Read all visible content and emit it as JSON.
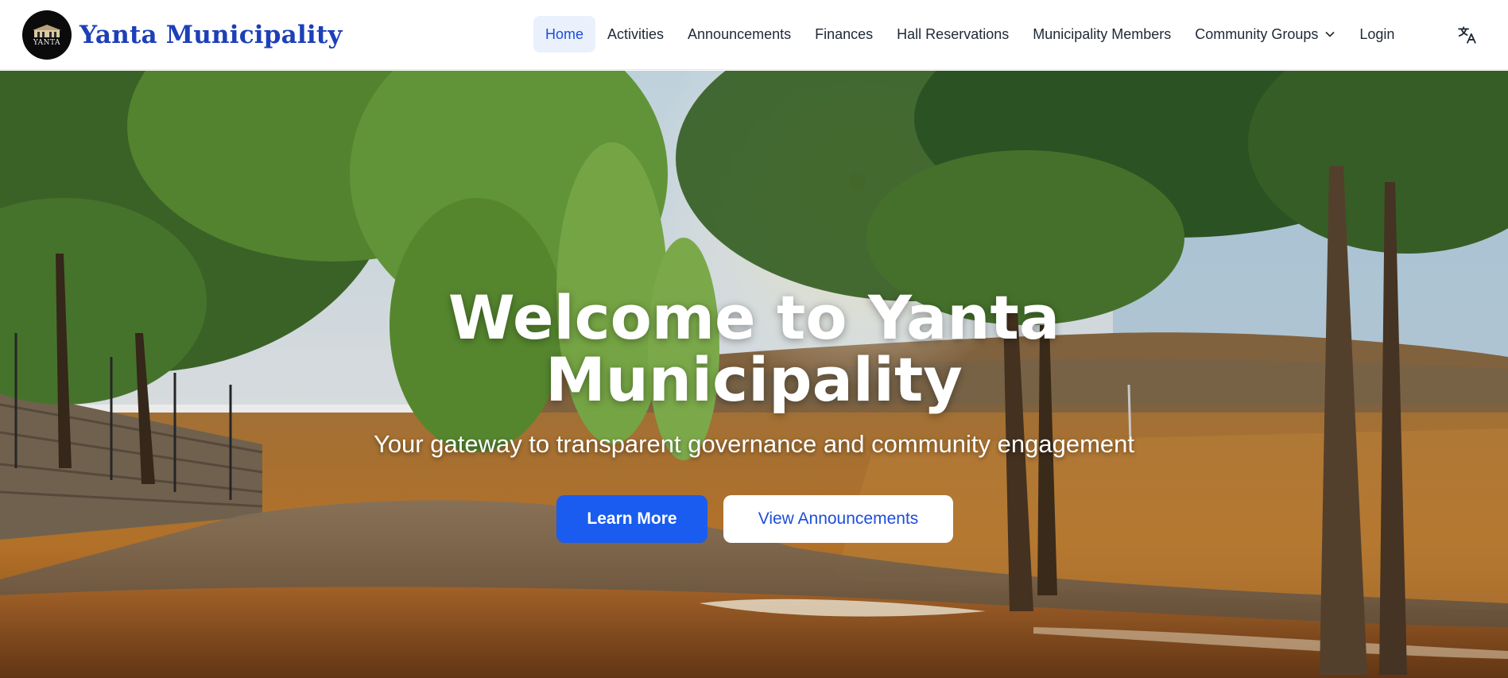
{
  "brand": {
    "name": "Yanta Municipality",
    "logo_text": "YANTA"
  },
  "nav": {
    "items": [
      {
        "label": "Home",
        "active": true
      },
      {
        "label": "Activities"
      },
      {
        "label": "Announcements"
      },
      {
        "label": "Finances"
      },
      {
        "label": "Hall Reservations"
      },
      {
        "label": "Municipality Members"
      },
      {
        "label": "Community Groups",
        "icon": "chevron-down-icon"
      },
      {
        "label": "Login"
      }
    ],
    "language_icon": "translate-icon"
  },
  "hero": {
    "title_line1": "Welcome to Yanta",
    "title_line2": "Municipality",
    "subtitle": "Your gateway to transparent governance and community engagement",
    "primary_button": "Learn More",
    "secondary_button": "View Announcements",
    "background": "sunlit tree-lined rural road with dry golden fields"
  },
  "colors": {
    "brand": "#1d3fb8",
    "accent": "#1a5cf0",
    "active_nav_bg": "#eaf1fd"
  }
}
